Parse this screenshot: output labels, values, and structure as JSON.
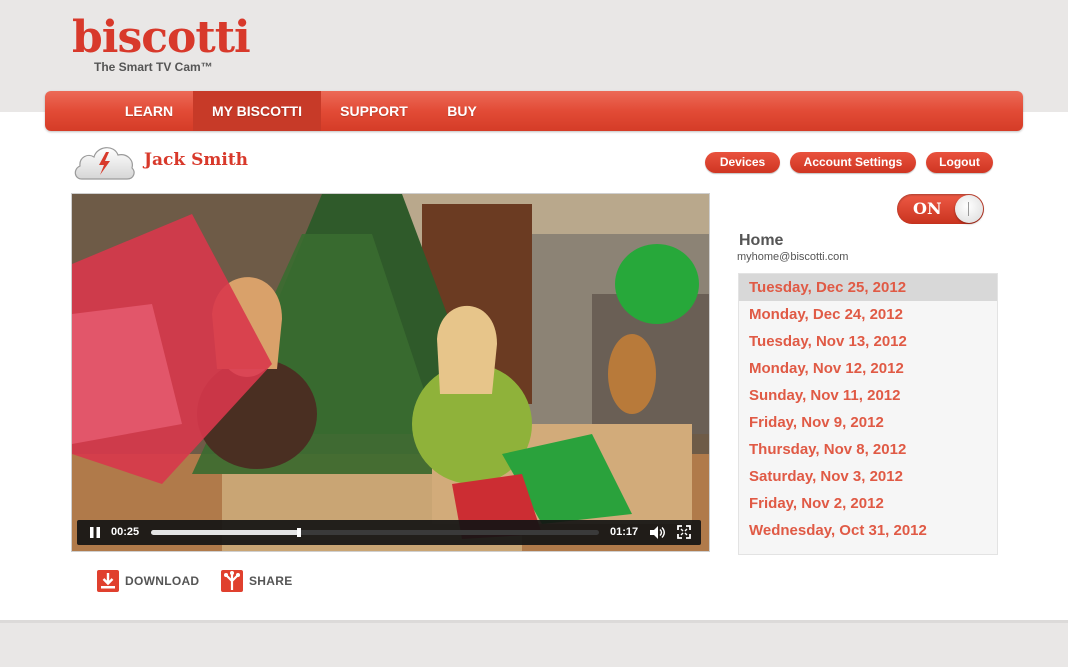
{
  "brand": {
    "name": "biscotti",
    "tagline": "The Smart TV Cam™"
  },
  "nav": {
    "items": [
      "LEARN",
      "MY BISCOTTI",
      "SUPPORT",
      "BUY"
    ],
    "active": "MY BISCOTTI"
  },
  "user": {
    "name": "Jack Smith",
    "icon": "cloud-lightning-icon"
  },
  "account_links": {
    "devices": "Devices",
    "settings": "Account Settings",
    "logout": "Logout"
  },
  "player": {
    "elapsed": "00:25",
    "duration": "01:17",
    "progress": 0.33,
    "state": "playing"
  },
  "actions": {
    "download": "DOWNLOAD",
    "share": "SHARE"
  },
  "camera": {
    "power": "ON",
    "device_name": "Home",
    "device_email": "myhome@biscotti.com"
  },
  "recordings": {
    "dates": [
      "Tuesday, Dec 25, 2012",
      "Monday, Dec 24, 2012",
      "Tuesday, Nov 13, 2012",
      "Monday, Nov 12, 2012",
      "Sunday, Nov 11, 2012",
      "Friday, Nov 9, 2012",
      "Thursday, Nov 8, 2012",
      "Saturday, Nov 3, 2012",
      "Friday, Nov 2, 2012",
      "Wednesday, Oct 31, 2012"
    ],
    "selected": 0
  },
  "colors": {
    "brand_red": "#d8392b",
    "nav_active": "#c73a28",
    "date_text": "#e05a45"
  }
}
